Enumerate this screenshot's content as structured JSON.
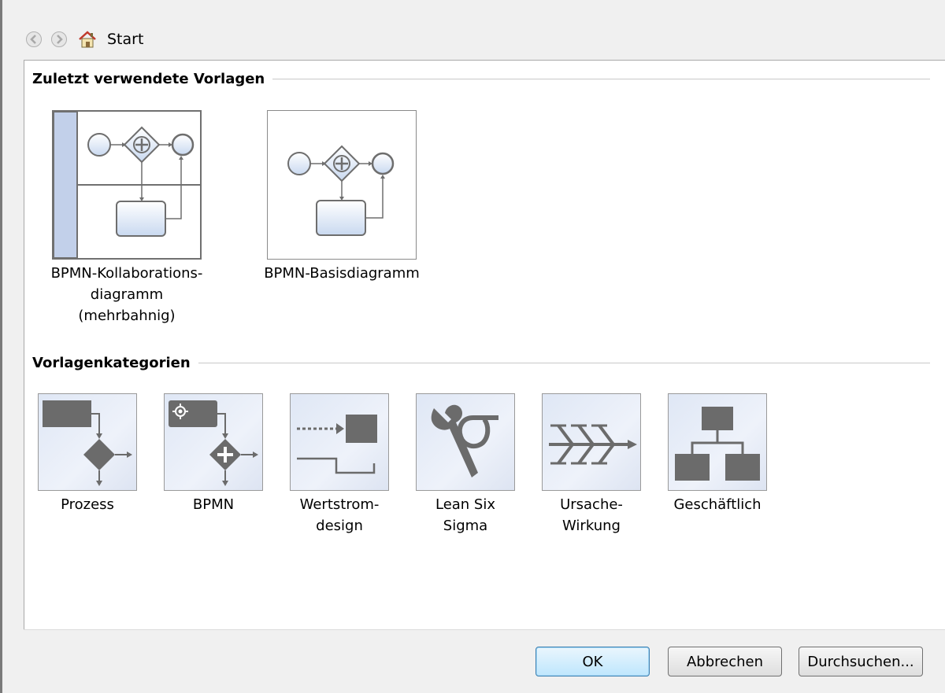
{
  "toolbar": {
    "back_icon": "back-arrow-icon",
    "forward_icon": "forward-arrow-icon",
    "home_icon": "home-icon",
    "location_label": "Start"
  },
  "recent": {
    "header": "Zuletzt verwendete Vorlagen",
    "items": [
      {
        "label_lines": [
          "BPMN-Kollaborations-",
          "diagramm",
          "(mehrbahnig)"
        ]
      },
      {
        "label_lines": [
          "BPMN-Basisdiagramm"
        ]
      }
    ]
  },
  "categories": {
    "header": "Vorlagenkategorien",
    "items": [
      {
        "label_lines": [
          "Prozess"
        ],
        "icon": "process-flow-icon"
      },
      {
        "label_lines": [
          "BPMN"
        ],
        "icon": "bpmn-icon"
      },
      {
        "label_lines": [
          "Wertstrom-",
          "design"
        ],
        "icon": "value-stream-icon"
      },
      {
        "label_lines": [
          "Lean Six",
          "Sigma"
        ],
        "icon": "wrench-sigma-icon"
      },
      {
        "label_lines": [
          "Ursache-",
          "Wirkung"
        ],
        "icon": "fishbone-icon"
      },
      {
        "label_lines": [
          "Geschäftlich"
        ],
        "icon": "org-chart-icon"
      }
    ]
  },
  "buttons": {
    "ok": "OK",
    "cancel": "Abbrechen",
    "browse": "Durchsuchen..."
  },
  "colors": {
    "icon_gray": "#6b6b6b",
    "thumb_blue": "#dfe7f5",
    "ok_border": "#3c7fb1"
  }
}
